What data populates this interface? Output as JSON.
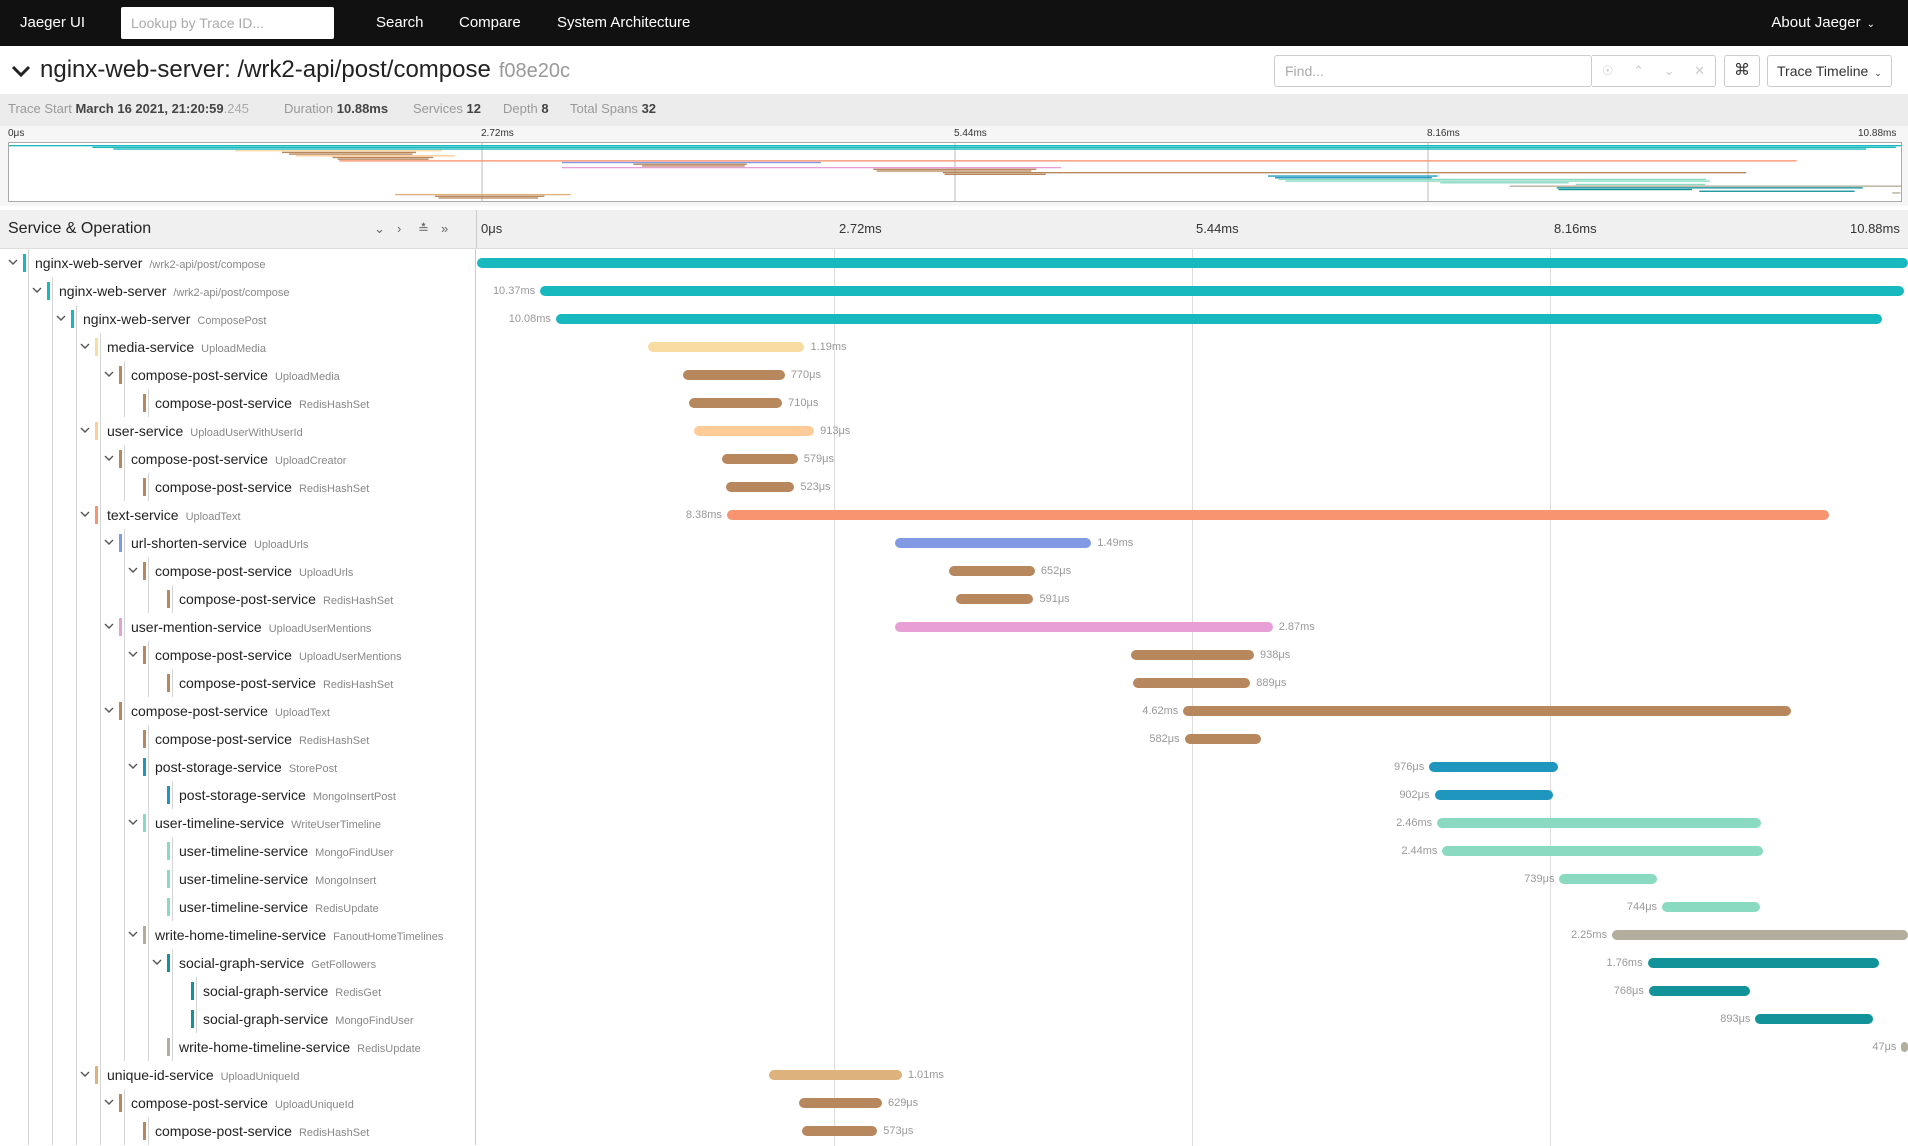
{
  "nav": {
    "brand": "Jaeger UI",
    "lookup_placeholder": "Lookup by Trace ID...",
    "links": [
      "Search",
      "Compare",
      "System Architecture"
    ],
    "about": "About Jaeger"
  },
  "trace": {
    "title": "nginx-web-server: /wrk2-api/post/compose",
    "trace_id": "f08e20c",
    "find_placeholder": "Find...",
    "view_select": "Trace Timeline"
  },
  "summary": {
    "trace_start_label": "Trace Start",
    "trace_start_value": "March 16 2021, 21:20:59",
    "trace_start_ms": ".245",
    "duration_label": "Duration",
    "duration_value": "10.88ms",
    "services_label": "Services",
    "services_value": "12",
    "depth_label": "Depth",
    "depth_value": "8",
    "total_spans_label": "Total Spans",
    "total_spans_value": "32"
  },
  "timeline": {
    "header_title": "Service & Operation",
    "ticks": [
      "0μs",
      "2.72ms",
      "5.44ms",
      "8.16ms",
      "10.88ms"
    ],
    "total_ms": 10.88
  },
  "colors": {
    "nginx": "#17b8be",
    "media": "#f8dca1",
    "compose": "#b7885e",
    "user": "#ffcb99",
    "text": "#f89570",
    "urlshorten": "#829ae3",
    "mention": "#e79fd5",
    "poststorage": "#1e96be",
    "usertimeline": "#89dac1",
    "writehome": "#b3ad9e",
    "socialgraph": "#12939a",
    "uniqueid": "#ddb27c"
  },
  "spans": [
    {
      "service": "nginx-web-server",
      "operation": "/wrk2-api/post/compose",
      "depth": 0,
      "expandable": true,
      "color": "nginx",
      "start": 0.0,
      "duration": 10.88,
      "label": "",
      "label_side": "none"
    },
    {
      "service": "nginx-web-server",
      "operation": "/wrk2-api/post/compose",
      "depth": 1,
      "expandable": true,
      "color": "nginx",
      "start": 0.48,
      "duration": 10.37,
      "label": "10.37ms",
      "label_side": "left"
    },
    {
      "service": "nginx-web-server",
      "operation": "ComposePost",
      "depth": 2,
      "expandable": true,
      "color": "nginx",
      "start": 0.6,
      "duration": 10.08,
      "label": "10.08ms",
      "label_side": "left"
    },
    {
      "service": "media-service",
      "operation": "UploadMedia",
      "depth": 3,
      "expandable": true,
      "color": "media",
      "start": 1.3,
      "duration": 1.19,
      "label": "1.19ms",
      "label_side": "right"
    },
    {
      "service": "compose-post-service",
      "operation": "UploadMedia",
      "depth": 4,
      "expandable": true,
      "color": "compose",
      "start": 1.57,
      "duration": 0.77,
      "label": "770μs",
      "label_side": "right"
    },
    {
      "service": "compose-post-service",
      "operation": "RedisHashSet",
      "depth": 5,
      "expandable": false,
      "color": "compose",
      "start": 1.61,
      "duration": 0.71,
      "label": "710μs",
      "label_side": "right"
    },
    {
      "service": "user-service",
      "operation": "UploadUserWithUserId",
      "depth": 3,
      "expandable": true,
      "color": "user",
      "start": 1.65,
      "duration": 0.913,
      "label": "913μs",
      "label_side": "right"
    },
    {
      "service": "compose-post-service",
      "operation": "UploadCreator",
      "depth": 4,
      "expandable": true,
      "color": "compose",
      "start": 1.86,
      "duration": 0.579,
      "label": "579μs",
      "label_side": "right"
    },
    {
      "service": "compose-post-service",
      "operation": "RedisHashSet",
      "depth": 5,
      "expandable": false,
      "color": "compose",
      "start": 1.89,
      "duration": 0.523,
      "label": "523μs",
      "label_side": "right"
    },
    {
      "service": "text-service",
      "operation": "UploadText",
      "depth": 3,
      "expandable": true,
      "color": "text",
      "start": 1.9,
      "duration": 8.38,
      "label": "8.38ms",
      "label_side": "left"
    },
    {
      "service": "url-shorten-service",
      "operation": "UploadUrls",
      "depth": 4,
      "expandable": true,
      "color": "urlshorten",
      "start": 3.18,
      "duration": 1.49,
      "label": "1.49ms",
      "label_side": "right"
    },
    {
      "service": "compose-post-service",
      "operation": "UploadUrls",
      "depth": 5,
      "expandable": true,
      "color": "compose",
      "start": 3.59,
      "duration": 0.652,
      "label": "652μs",
      "label_side": "right"
    },
    {
      "service": "compose-post-service",
      "operation": "RedisHashSet",
      "depth": 6,
      "expandable": false,
      "color": "compose",
      "start": 3.64,
      "duration": 0.591,
      "label": "591μs",
      "label_side": "right"
    },
    {
      "service": "user-mention-service",
      "operation": "UploadUserMentions",
      "depth": 4,
      "expandable": true,
      "color": "mention",
      "start": 3.18,
      "duration": 2.87,
      "label": "2.87ms",
      "label_side": "right"
    },
    {
      "service": "compose-post-service",
      "operation": "UploadUserMentions",
      "depth": 5,
      "expandable": true,
      "color": "compose",
      "start": 4.97,
      "duration": 0.938,
      "label": "938μs",
      "label_side": "right"
    },
    {
      "service": "compose-post-service",
      "operation": "RedisHashSet",
      "depth": 6,
      "expandable": false,
      "color": "compose",
      "start": 4.99,
      "duration": 0.889,
      "label": "889μs",
      "label_side": "right"
    },
    {
      "service": "compose-post-service",
      "operation": "UploadText",
      "depth": 4,
      "expandable": true,
      "color": "compose",
      "start": 5.37,
      "duration": 4.62,
      "label": "4.62ms",
      "label_side": "left"
    },
    {
      "service": "compose-post-service",
      "operation": "RedisHashSet",
      "depth": 5,
      "expandable": false,
      "color": "compose",
      "start": 5.38,
      "duration": 0.582,
      "label": "582μs",
      "label_side": "left"
    },
    {
      "service": "post-storage-service",
      "operation": "StorePost",
      "depth": 5,
      "expandable": true,
      "color": "poststorage",
      "start": 7.24,
      "duration": 0.976,
      "label": "976μs",
      "label_side": "left"
    },
    {
      "service": "post-storage-service",
      "operation": "MongoInsertPost",
      "depth": 6,
      "expandable": false,
      "color": "poststorage",
      "start": 7.28,
      "duration": 0.902,
      "label": "902μs",
      "label_side": "left"
    },
    {
      "service": "user-timeline-service",
      "operation": "WriteUserTimeline",
      "depth": 5,
      "expandable": true,
      "color": "usertimeline",
      "start": 7.3,
      "duration": 2.46,
      "label": "2.46ms",
      "label_side": "left"
    },
    {
      "service": "user-timeline-service",
      "operation": "MongoFindUser",
      "depth": 6,
      "expandable": false,
      "color": "usertimeline",
      "start": 7.34,
      "duration": 2.44,
      "label": "2.44ms",
      "label_side": "left"
    },
    {
      "service": "user-timeline-service",
      "operation": "MongoInsert",
      "depth": 6,
      "expandable": false,
      "color": "usertimeline",
      "start": 8.23,
      "duration": 0.739,
      "label": "739μs",
      "label_side": "left"
    },
    {
      "service": "user-timeline-service",
      "operation": "RedisUpdate",
      "depth": 6,
      "expandable": false,
      "color": "usertimeline",
      "start": 9.01,
      "duration": 0.744,
      "label": "744μs",
      "label_side": "left"
    },
    {
      "service": "write-home-timeline-service",
      "operation": "FanoutHomeTimelines",
      "depth": 5,
      "expandable": true,
      "color": "writehome",
      "start": 8.63,
      "duration": 2.25,
      "label": "2.25ms",
      "label_side": "left"
    },
    {
      "service": "social-graph-service",
      "operation": "GetFollowers",
      "depth": 6,
      "expandable": true,
      "color": "socialgraph",
      "start": 8.9,
      "duration": 1.76,
      "label": "1.76ms",
      "label_side": "left"
    },
    {
      "service": "social-graph-service",
      "operation": "RedisGet",
      "depth": 7,
      "expandable": false,
      "color": "socialgraph",
      "start": 8.91,
      "duration": 0.768,
      "label": "768μs",
      "label_side": "left"
    },
    {
      "service": "social-graph-service",
      "operation": "MongoFindUser",
      "depth": 7,
      "expandable": false,
      "color": "socialgraph",
      "start": 9.72,
      "duration": 0.893,
      "label": "893μs",
      "label_side": "left"
    },
    {
      "service": "write-home-timeline-service",
      "operation": "RedisUpdate",
      "depth": 6,
      "expandable": false,
      "color": "writehome",
      "start": 10.83,
      "duration": 0.047,
      "label": "47μs",
      "label_side": "left"
    },
    {
      "service": "unique-id-service",
      "operation": "UploadUniqueId",
      "depth": 3,
      "expandable": true,
      "color": "uniqueid",
      "start": 2.22,
      "duration": 1.01,
      "label": "1.01ms",
      "label_side": "right"
    },
    {
      "service": "compose-post-service",
      "operation": "UploadUniqueId",
      "depth": 4,
      "expandable": true,
      "color": "compose",
      "start": 2.45,
      "duration": 0.629,
      "label": "629μs",
      "label_side": "right"
    },
    {
      "service": "compose-post-service",
      "operation": "RedisHashSet",
      "depth": 5,
      "expandable": false,
      "color": "compose",
      "start": 2.47,
      "duration": 0.573,
      "label": "573μs",
      "label_side": "right"
    }
  ]
}
